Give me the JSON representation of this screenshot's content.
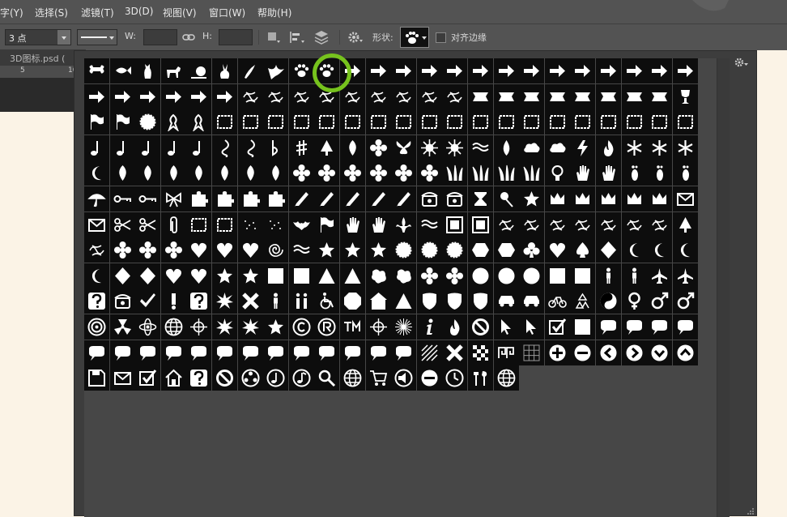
{
  "menubar": {
    "items": [
      "字(Y)",
      "选择(S)",
      "滤镜(T)",
      "3D(D)",
      "视图(V)",
      "窗口(W)",
      "帮助(H)"
    ]
  },
  "options": {
    "stroke_size_value": "3 点",
    "w_label": "W:",
    "h_label": "H:",
    "shape_label": "形状:",
    "align_edges_label": "对齐边缘"
  },
  "document": {
    "tab_label": "3D图标.psd (",
    "ruler_numbers": [
      "5",
      "10"
    ]
  },
  "shapes": {
    "selected": "paw-print",
    "highlight_color": "#76c21d",
    "rows": [
      [
        "bone",
        "fish",
        "cat",
        "dog",
        "snail",
        "rabbit",
        "bird",
        "dove",
        "paw-print",
        "paw-print",
        "arrow",
        "arrow",
        "arrow",
        "arrow",
        "arrow",
        "arrow",
        "arrow",
        "arrow",
        "arrow",
        "arrow",
        "arrow",
        "arrow",
        "arrow",
        "arrow"
      ],
      [
        "arrow",
        "arrow",
        "arrow",
        "arrow",
        "arrow",
        "arrow",
        "ornament",
        "ornament",
        "ornament",
        "ornament",
        "ornament",
        "ornament",
        "ornament",
        "ornament",
        "ornament",
        "banner",
        "banner",
        "banner",
        "banner",
        "banner",
        "banner",
        "banner",
        "banner",
        "trophy"
      ],
      [
        "flag",
        "flag",
        "seal",
        "ribbon",
        "ribbon",
        "frame",
        "frame",
        "frame",
        "frame",
        "frame",
        "frame",
        "frame",
        "frame",
        "frame",
        "frame",
        "frame",
        "frame",
        "frame",
        "frame",
        "frame",
        "frame",
        "frame",
        "frame",
        "frame"
      ],
      [
        "note",
        "note",
        "note",
        "note",
        "note",
        "clef",
        "clef",
        "flat",
        "sharp",
        "tree",
        "leaf",
        "flower",
        "butterfly",
        "sun",
        "sun",
        "wave",
        "drop",
        "cloud",
        "cloud",
        "lightning",
        "fire",
        "snowflake",
        "snowflake",
        "snowflake"
      ],
      [
        "moon",
        "leaf",
        "leaf",
        "leaf",
        "leaf",
        "leaf",
        "leaf",
        "leaf",
        "flower",
        "flower",
        "flower",
        "flower",
        "flower",
        "flower",
        "grass",
        "grass",
        "grass",
        "grass",
        "bulb",
        "hand",
        "hand",
        "foot",
        "foot",
        "foot"
      ],
      [
        "umbrella",
        "key",
        "key",
        "bow",
        "puzzle",
        "puzzle",
        "puzzle",
        "puzzle",
        "pen",
        "pen",
        "pen",
        "pen",
        "pen",
        "phone",
        "phone",
        "hourglass",
        "pin",
        "star",
        "crown",
        "crown",
        "crown",
        "crown",
        "crown",
        "envelope"
      ],
      [
        "envelope",
        "scissors",
        "scissors",
        "clip",
        "frame",
        "frame",
        "dots",
        "dots",
        "bat",
        "flag",
        "hand",
        "hand",
        "fleur",
        "wave",
        "tile",
        "tile",
        "ornament",
        "ornament",
        "ornament",
        "ornament",
        "ornament",
        "ornament",
        "ornament",
        "tree"
      ],
      [
        "ornament",
        "flower",
        "flower",
        "flower",
        "heart",
        "heart",
        "heart",
        "spiral",
        "wave",
        "star",
        "star",
        "star",
        "seal",
        "seal",
        "seal",
        "hexagon",
        "hexagon",
        "club",
        "heart",
        "spade",
        "diamond",
        "moon",
        "moon",
        "moon"
      ],
      [
        "moon",
        "diamond",
        "diamond",
        "heart",
        "heart",
        "star",
        "star",
        "square",
        "square",
        "triangle",
        "triangle",
        "blob",
        "blob",
        "flower",
        "flower",
        "circle",
        "circle",
        "circle",
        "square",
        "square",
        "person",
        "person",
        "airplane",
        "airplane"
      ],
      [
        "question",
        "phone",
        "check",
        "exclaim",
        "question",
        "burst",
        "x",
        "person",
        "people",
        "wheelchair",
        "octagon",
        "house",
        "triangle",
        "shield",
        "shield",
        "shield",
        "car",
        "car",
        "bike",
        "recycle",
        "yin-yang",
        "female",
        "male",
        "male"
      ],
      [
        "target",
        "radiation",
        "atom",
        "globe",
        "crosshair",
        "burst",
        "burst",
        "star",
        "copyright",
        "registered",
        "trademark",
        "crosshair",
        "sunburst",
        "info",
        "fire",
        "no",
        "cursor",
        "cursor",
        "checkbox",
        "square",
        "bubble",
        "bubble",
        "bubble",
        "bubble"
      ],
      [
        "bubble",
        "bubble",
        "bubble",
        "bubble",
        "bubble",
        "bubble",
        "bubble",
        "bubble",
        "bubble",
        "bubble",
        "bubble",
        "bubble",
        "bubble",
        "hatch",
        "x",
        "checker",
        "greek",
        "grid",
        "plus",
        "minus",
        "left",
        "right",
        "down",
        "up"
      ],
      [
        "save",
        "envelope",
        "checkbox",
        "home",
        "question",
        "no",
        "film",
        "note-add",
        "note-remove",
        "search",
        "globe",
        "cart",
        "speaker",
        "minus",
        "clock",
        "tools",
        "globe"
      ]
    ]
  }
}
